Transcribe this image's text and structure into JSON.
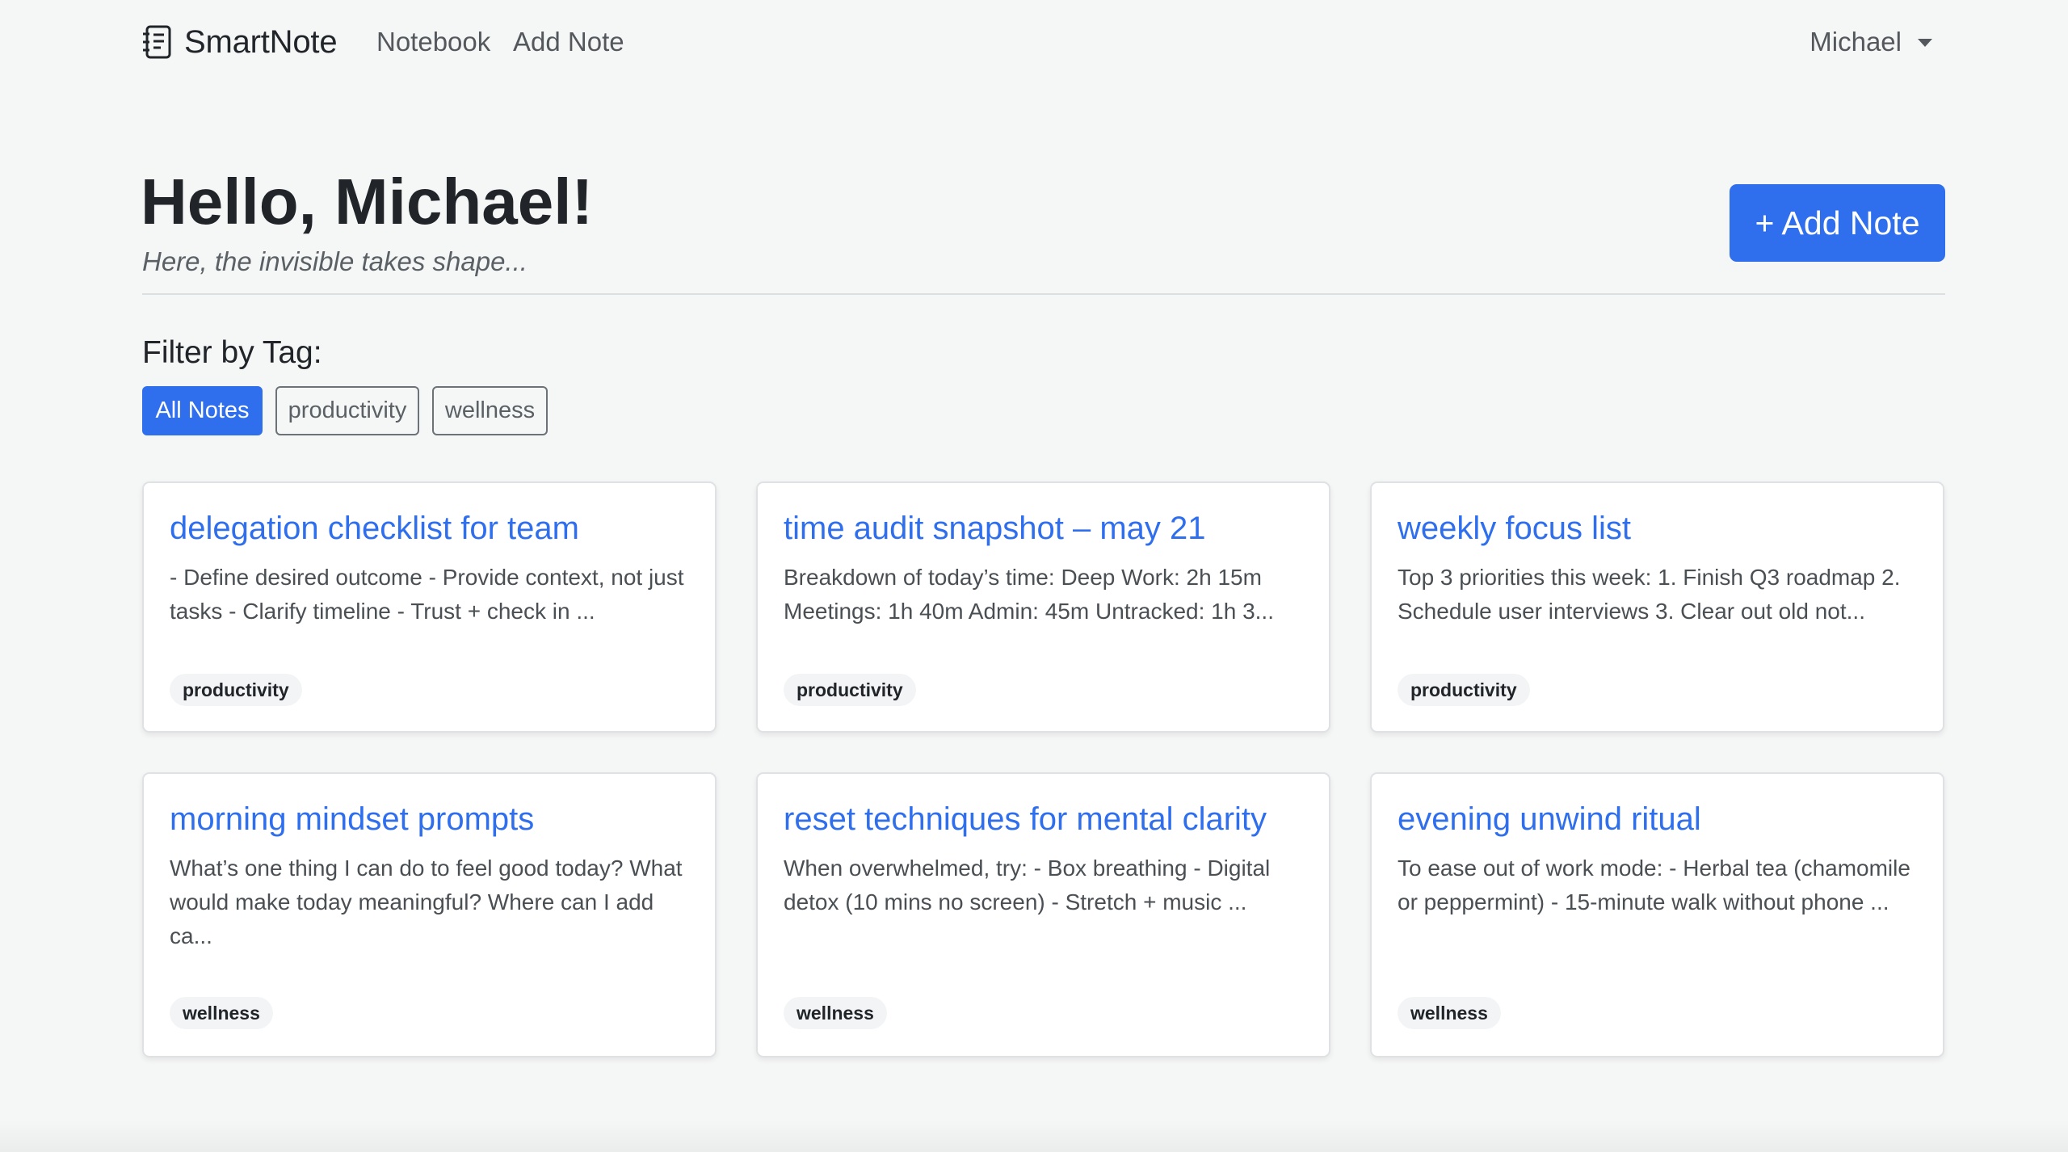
{
  "nav": {
    "brand": "SmartNote",
    "brand_icon": "notebook-icon",
    "links": [
      {
        "label": "Notebook"
      },
      {
        "label": "Add Note"
      }
    ],
    "user": "Michael",
    "user_menu_icon": "caret-down-icon"
  },
  "header": {
    "greeting": "Hello, Michael!",
    "subtitle": "Here, the invisible takes shape...",
    "add_button": "+ Add Note"
  },
  "filter": {
    "label": "Filter by Tag:",
    "tags": [
      {
        "label": "All Notes",
        "active": true
      },
      {
        "label": "productivity",
        "active": false
      },
      {
        "label": "wellness",
        "active": false
      }
    ]
  },
  "notes": [
    {
      "title": "delegation checklist for team",
      "excerpt": "- Define desired outcome - Provide context, not just tasks - Clarify timeline - Trust + check in ...",
      "tag": "productivity"
    },
    {
      "title": "time audit snapshot – may 21",
      "excerpt": "Breakdown of today’s time: Deep Work: 2h 15m Meetings: 1h 40m Admin: 45m Untracked: 1h 3...",
      "tag": "productivity"
    },
    {
      "title": "weekly focus list",
      "excerpt": "Top 3 priorities this week: 1. Finish Q3 roadmap 2. Schedule user interviews 3. Clear out old not...",
      "tag": "productivity"
    },
    {
      "title": "morning mindset prompts",
      "excerpt": "What’s one thing I can do to feel good today? What would make today meaningful? Where can I add ca...",
      "tag": "wellness"
    },
    {
      "title": "reset techniques for mental clarity",
      "excerpt": "When overwhelmed, try: - Box breathing - Digital detox (10 mins no screen) - Stretch + music ...",
      "tag": "wellness"
    },
    {
      "title": "evening unwind ritual",
      "excerpt": "To ease out of work mode: - Herbal tea (chamomile or peppermint) - 15-minute walk without phone ...",
      "tag": "wellness"
    }
  ],
  "colors": {
    "accent": "#2f6fed",
    "background": "#f5f6f6",
    "card_background": "#ffffff",
    "tag_background": "#f3f4f5"
  }
}
